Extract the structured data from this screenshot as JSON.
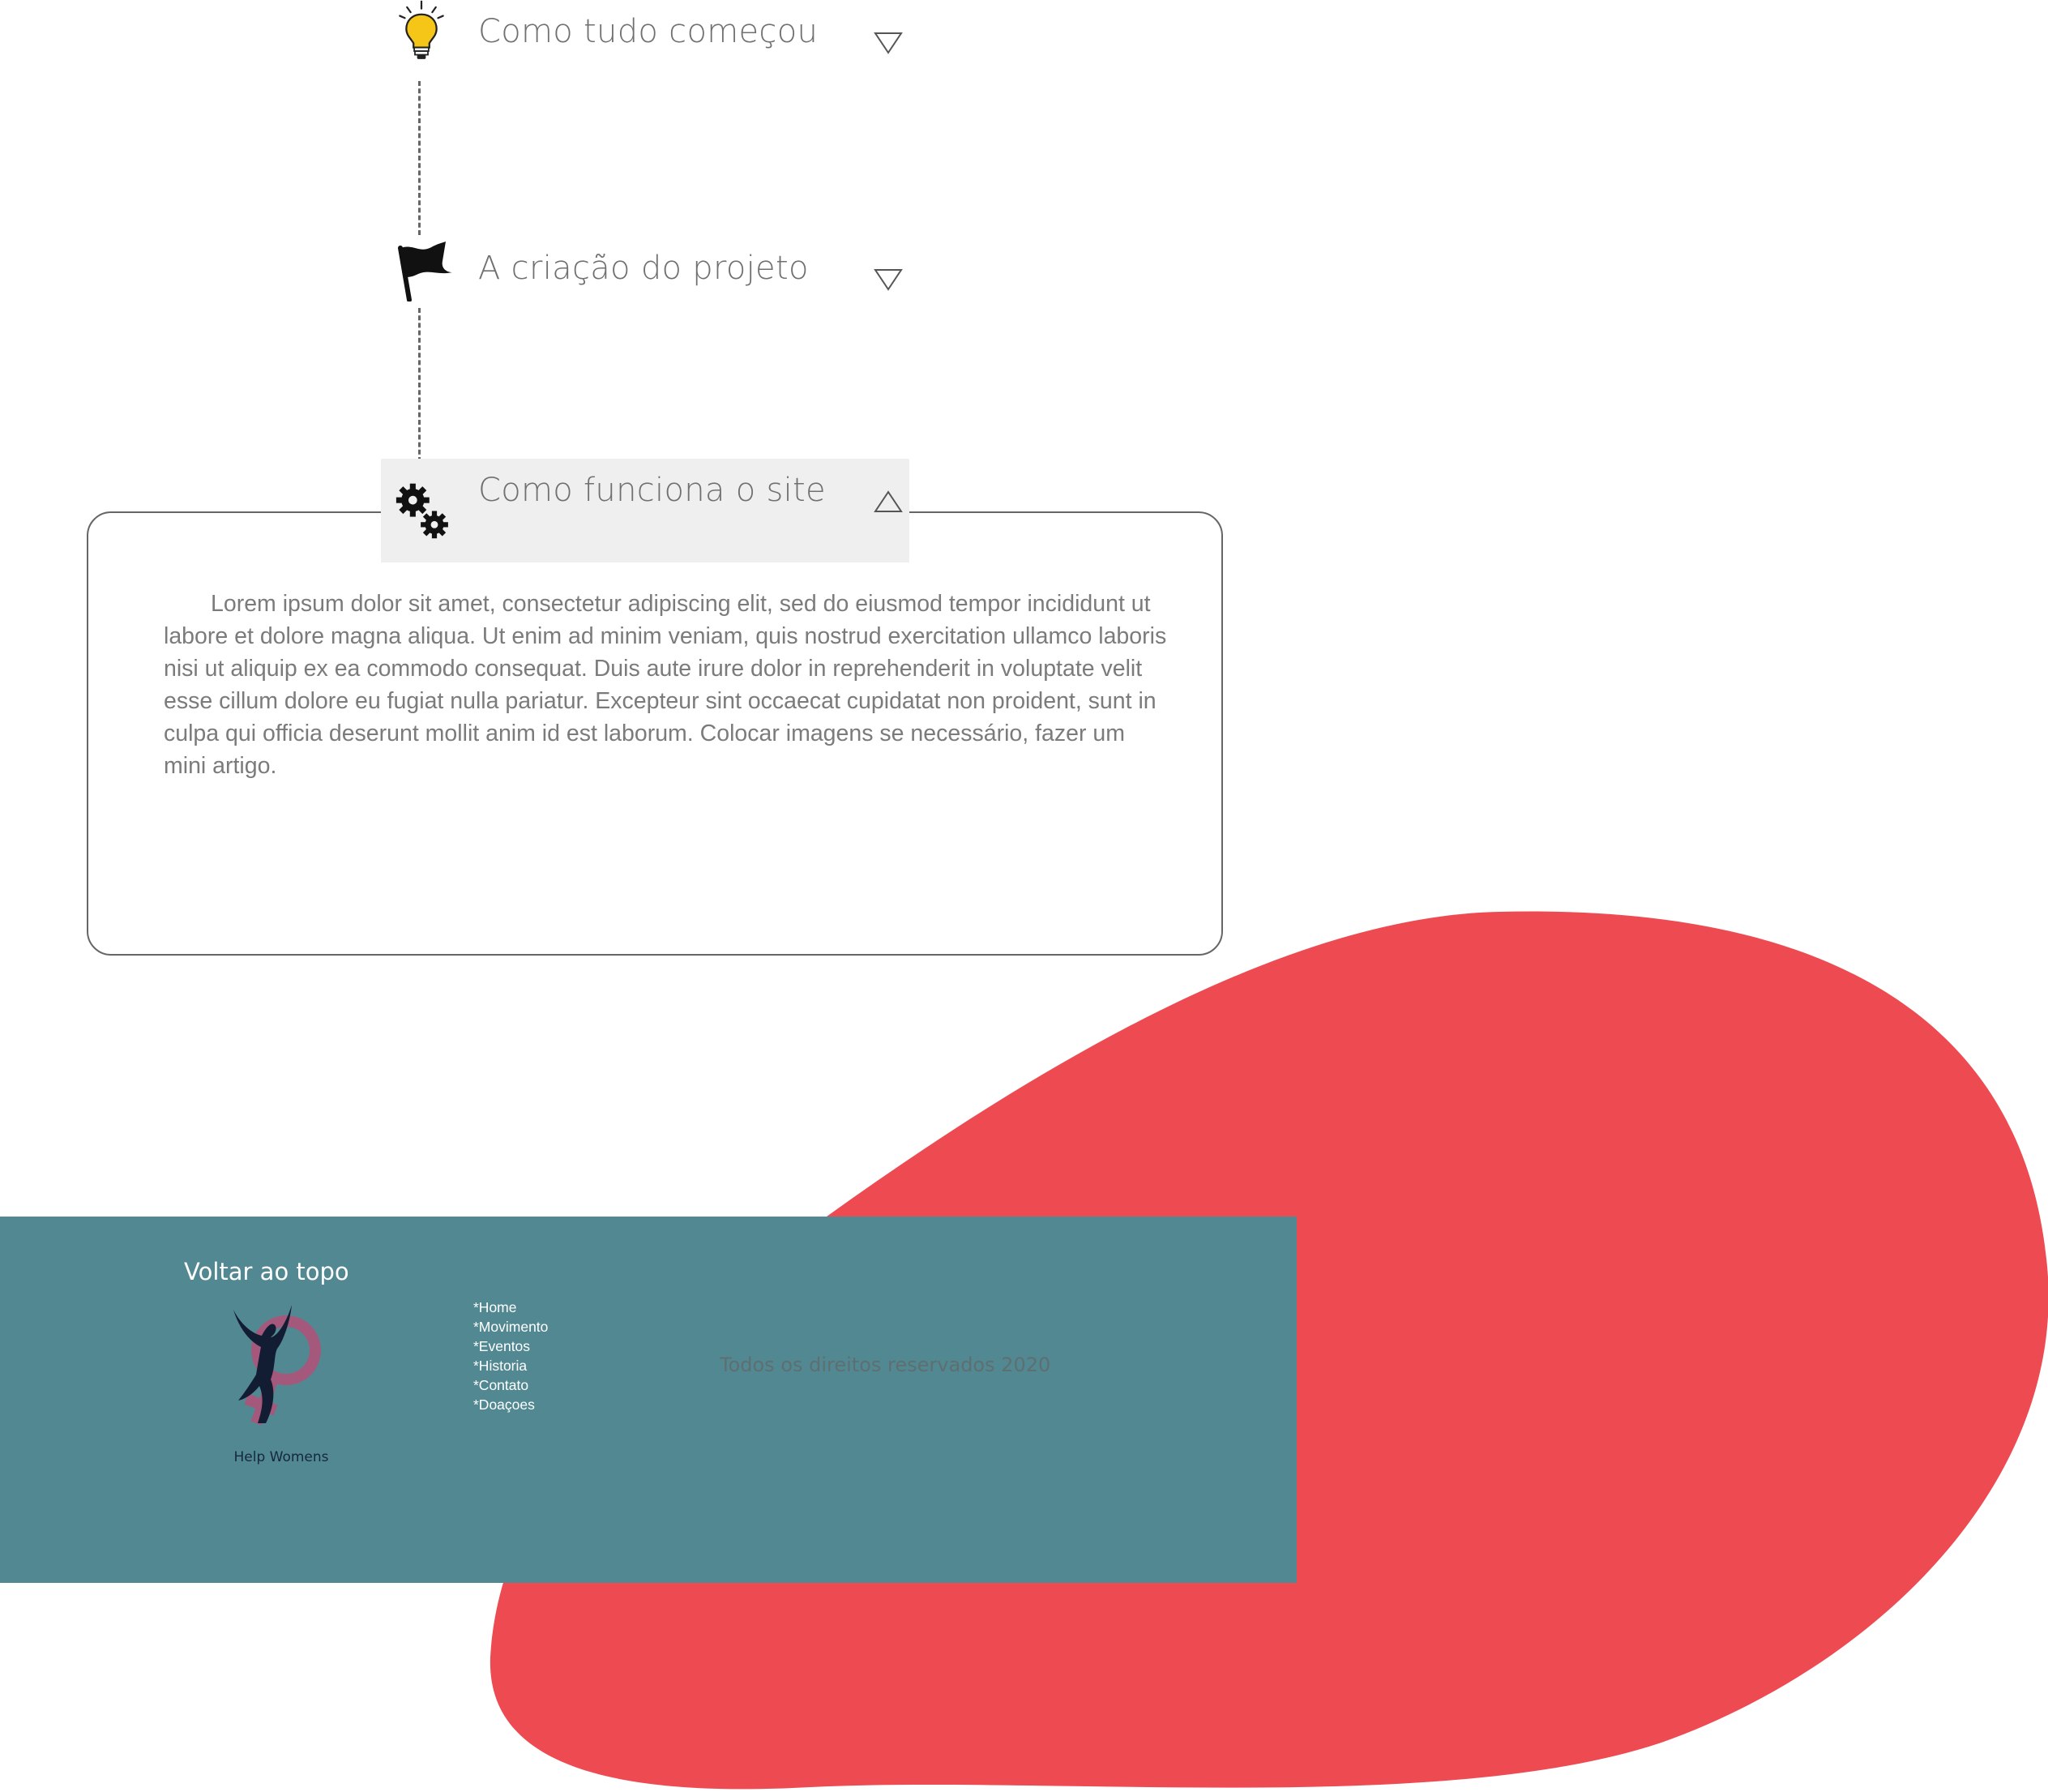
{
  "accordion": {
    "items": [
      {
        "title": "Como tudo começou",
        "icon": "lightbulb-icon",
        "arrow": "triangle-down-icon",
        "expanded": false
      },
      {
        "title": "A criação do projeto",
        "icon": "flag-icon",
        "arrow": "triangle-down-icon",
        "expanded": false
      },
      {
        "title": "Como funciona o site",
        "icon": "gears-icon",
        "arrow": "triangle-up-icon",
        "expanded": true
      }
    ],
    "content": "Lorem ipsum dolor sit amet, consectetur adipiscing elit, sed do eiusmod tempor incididunt ut labore et dolore magna aliqua. Ut enim ad minim veniam, quis nostrud exercitation ullamco laboris nisi ut aliquip ex ea commodo consequat. Duis aute irure dolor in reprehenderit in voluptate velit esse cillum dolore eu fugiat nulla pariatur. Excepteur sint occaecat cupidatat non proident, sunt in culpa qui officia deserunt mollit anim id est laborum. Colocar imagens se necessário, fazer um mini artigo."
  },
  "footer": {
    "back_to_top": "Voltar ao topo",
    "logo_text": "Help Womens",
    "menu": [
      "*Home",
      "*Movimento",
      "*Eventos",
      "*Historia",
      "*Contato",
      "*Doaçoes"
    ],
    "copyright": "Todos os direitos reservados 2020"
  },
  "colors": {
    "blob": "#ee4a51",
    "footer_bg": "#528892",
    "active_header_bg": "#efefef",
    "bulb": "#f5c518"
  }
}
